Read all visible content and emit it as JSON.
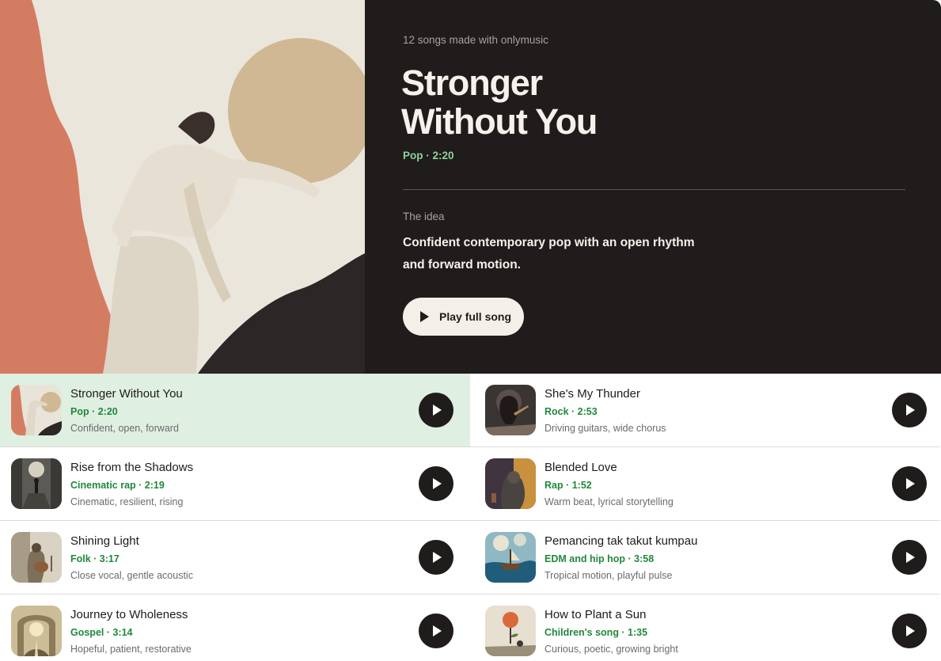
{
  "hero": {
    "count_text": "12 songs made with onlymusic",
    "title_line1": "Stronger",
    "title_line2": "Without You",
    "meta": "Pop · 2:20",
    "idea_label": "The idea",
    "idea_text": "Confident contemporary pop with an open rhythm and forward motion.",
    "play_label": "Play full song",
    "artwork_icon": "woman-dancing-collage-artwork"
  },
  "songs": [
    {
      "title": "Stronger Without You",
      "meta": "Pop · 2:20",
      "desc": "Confident, open, forward",
      "active": true,
      "thumb_icon": "dancer-thumbnail"
    },
    {
      "title": "She's My Thunder",
      "meta": "Rock · 2:53",
      "desc": "Driving guitars, wide chorus",
      "active": false,
      "thumb_icon": "guitarist-thumbnail"
    },
    {
      "title": "Rise from the Shadows",
      "meta": "Cinematic rap · 2:19",
      "desc": "Cinematic, resilient, rising",
      "active": false,
      "thumb_icon": "stairs-figure-thumbnail"
    },
    {
      "title": "Blended Love",
      "meta": "Rap · 1:52",
      "desc": "Warm beat, lyrical storytelling",
      "active": false,
      "thumb_icon": "gorilla-thumbnail"
    },
    {
      "title": "Shining Light",
      "meta": "Folk · 3:17",
      "desc": "Close vocal, gentle acoustic",
      "active": false,
      "thumb_icon": "acoustic-player-thumbnail"
    },
    {
      "title": "Pemancing tak takut kumpau",
      "meta": "EDM and hip hop · 3:58",
      "desc": "Tropical motion, playful pulse",
      "active": false,
      "thumb_icon": "boat-at-sea-thumbnail"
    },
    {
      "title": "Journey to Wholeness",
      "meta": "Gospel · 3:14",
      "desc": "Hopeful, patient, restorative",
      "active": false,
      "thumb_icon": "arch-path-thumbnail"
    },
    {
      "title": "How to Plant a Sun",
      "meta": "Children's song · 1:35",
      "desc": "Curious, poetic, growing bright",
      "active": false,
      "thumb_icon": "sun-seedling-thumbnail"
    }
  ],
  "colors": {
    "hero_panel": "#1f1c1b",
    "accent_green": "#23873c",
    "hero_green": "#8fd19e",
    "active_row": "#dfefe2",
    "play_button": "#1f1c1b"
  }
}
